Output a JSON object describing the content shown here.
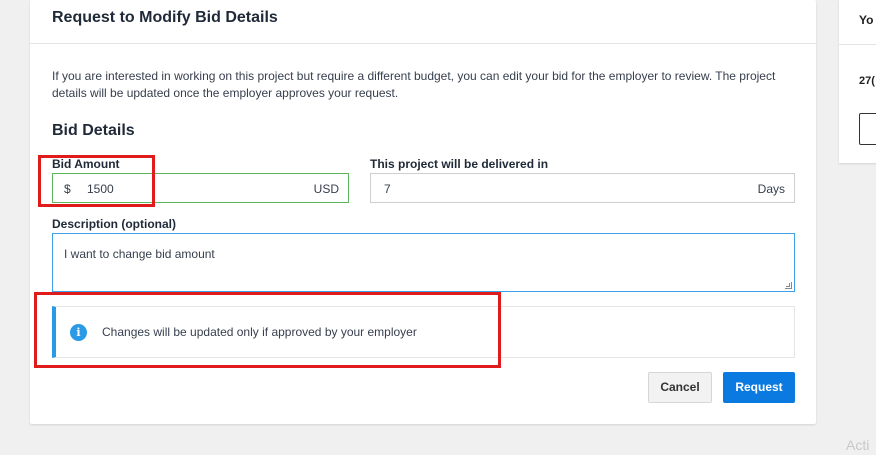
{
  "modal": {
    "title": "Request to Modify Bid Details",
    "intro": "If you are interested in working on this project but require a different budget, you can edit your bid for the employer to review. The project details will be updated once the employer approves your request.",
    "section_title": "Bid Details",
    "bid_amount": {
      "label": "Bid Amount",
      "currency_symbol": "$",
      "value": "1500",
      "currency": "USD"
    },
    "delivery": {
      "label": "This project will be delivered in",
      "value": "7",
      "unit": "Days"
    },
    "description": {
      "label": "Description (optional)",
      "value": "I want to change bid amount"
    },
    "notice": {
      "icon": "info-icon",
      "text": "Changes will be updated only if approved by your employer"
    },
    "buttons": {
      "cancel": "Cancel",
      "request": "Request"
    }
  },
  "side_panel": {
    "title": "Yo",
    "number": "27("
  },
  "watermark": "Acti",
  "colors": {
    "primary": "#0b7ae0",
    "info": "#2a9ae6",
    "highlight": "#e01b1b",
    "valid_border": "#5cb85c"
  }
}
